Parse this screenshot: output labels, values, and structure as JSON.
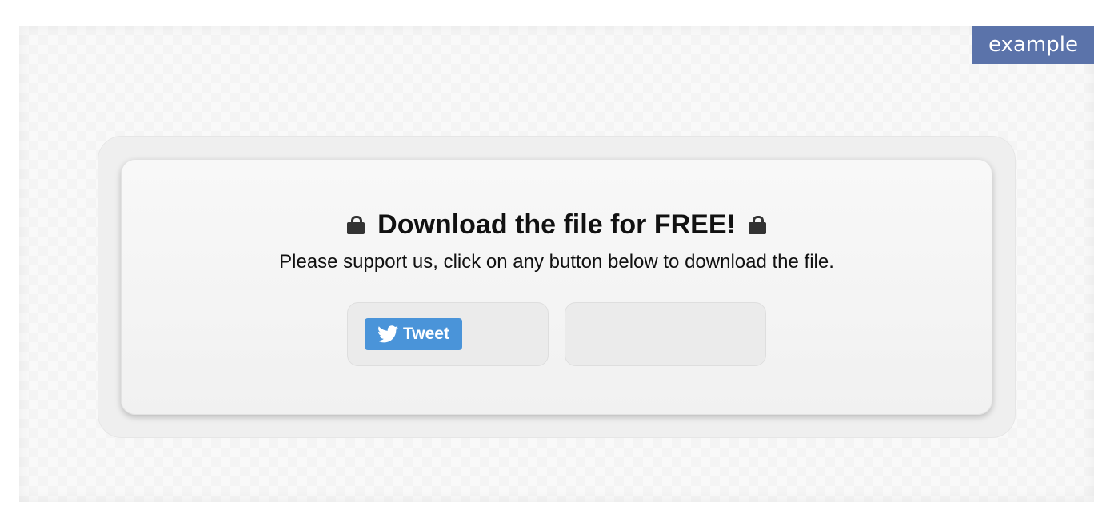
{
  "corner_tag": {
    "label": "example"
  },
  "card": {
    "title": "Download the file for FREE!",
    "subtitle": "Please support us, click on any button below to download the file.",
    "title_icon": "lock-icon"
  },
  "share_buttons": [
    {
      "label": "Tweet",
      "icon": "twitter-bird-icon",
      "color": "#4a94d9"
    }
  ],
  "colors": {
    "tag_background": "#5b73aa",
    "tweet_button": "#4a94d9"
  }
}
